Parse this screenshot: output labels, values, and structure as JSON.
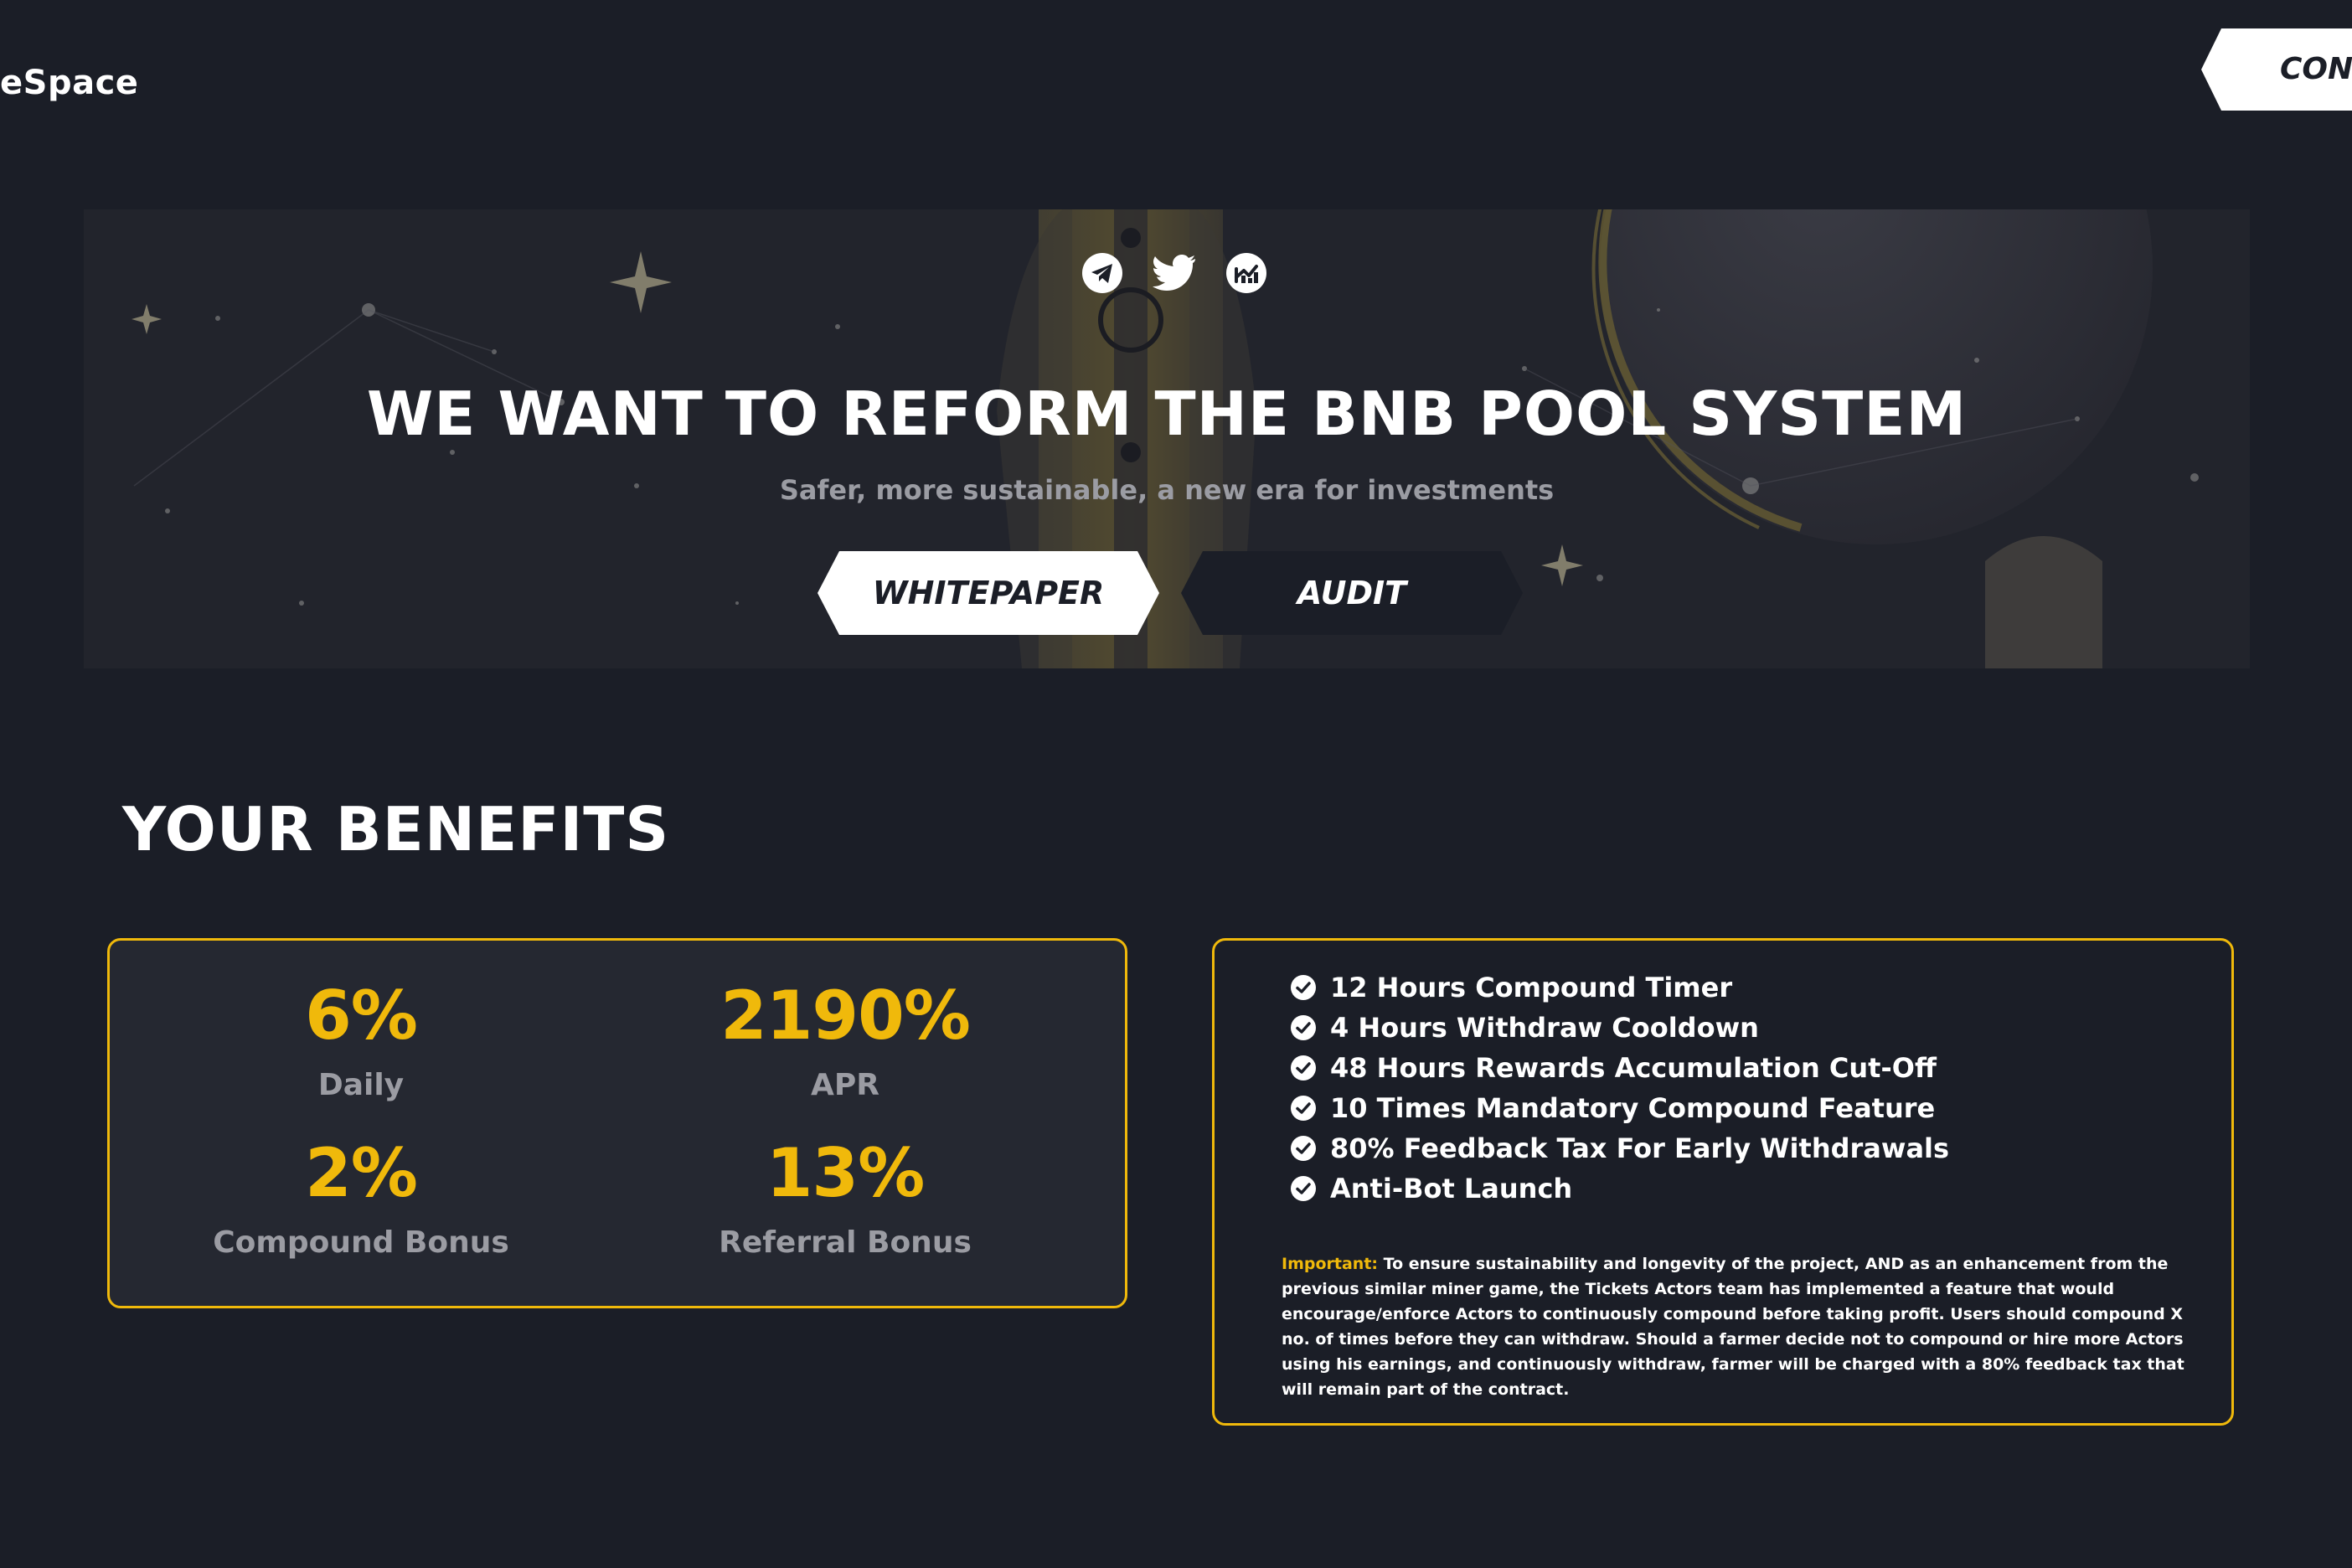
{
  "header": {
    "brand": "eSpace",
    "connect_label": "CON"
  },
  "hero": {
    "socials": [
      {
        "icon": "telegram-icon"
      },
      {
        "icon": "twitter-icon"
      },
      {
        "icon": "chart-icon"
      }
    ],
    "title": "WE WANT TO REFORM THE BNB POOL SYSTEM",
    "subtitle": "Safer, more sustainable, a new era for investments",
    "whitepaper_label": "WHITEPAPER",
    "audit_label": "AUDIT"
  },
  "benefits": {
    "title": "YOUR BENEFITS",
    "stats": [
      {
        "value": "6%",
        "label": "Daily"
      },
      {
        "value": "2190%",
        "label": "APR"
      },
      {
        "value": "2%",
        "label": "Compound Bonus"
      },
      {
        "value": "13%",
        "label": "Referral Bonus"
      }
    ],
    "features": [
      "12 Hours Compound Timer",
      "4 Hours Withdraw Cooldown",
      "48 Hours Rewards Accumulation Cut-Off",
      "10 Times Mandatory Compound Feature",
      "80% Feedback Tax For Early Withdrawals",
      "Anti-Bot Launch"
    ],
    "note_label": "Important:",
    "note_text": "To ensure sustainability and longevity of the project, AND as an enhancement from the previous similar miner game, the Tickets Actors team has implemented a feature that would encourage/enforce Actors to continuously compound before taking profit. Users should compound X no. of times before they can withdraw. Should a farmer decide not to compound or hire more Actors using his earnings, and continuously withdraw, farmer will be charged with a 80% feedback tax that will remain part of the contract."
  },
  "colors": {
    "background": "#1b1e27",
    "accent": "#f0b90b",
    "card": "#252831",
    "muted_text": "#9b9ca3"
  }
}
